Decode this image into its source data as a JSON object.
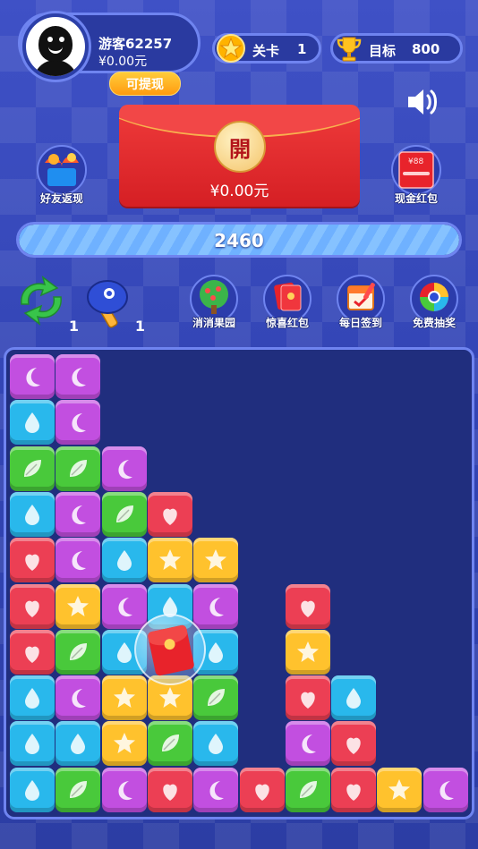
{
  "player": {
    "name": "游客62257",
    "money": "¥0.00元",
    "withdraw_label": "可提现"
  },
  "level": {
    "label": "关卡",
    "value": "1"
  },
  "target": {
    "label": "目标",
    "value": "800"
  },
  "red_packet": {
    "open_char": "開",
    "amount": "¥0.00元"
  },
  "side_buttons": {
    "friend_cashback": "好友返现",
    "cash_red_packet": "现金红包",
    "cash_red_packet_badge": "¥88"
  },
  "score": {
    "value": "2460",
    "progress": 1.0
  },
  "tools": {
    "refresh": {
      "icon": "refresh-arrows-icon",
      "count": "1"
    },
    "hammer": {
      "icon": "hammer-icon",
      "count": "1"
    }
  },
  "features": [
    {
      "label": "消消果园",
      "icon": "tree-icon"
    },
    {
      "label": "惊喜红包",
      "icon": "red-envelope-icon"
    },
    {
      "label": "每日签到",
      "icon": "calendar-icon"
    },
    {
      "label": "免费抽奖",
      "icon": "prize-wheel-icon"
    }
  ],
  "colors": {
    "purple": "#c24fe0",
    "blue": "#29b8ec",
    "green": "#49c93b",
    "red": "#ec3f54",
    "yellow": "#ffc22d",
    "accent": "#6f84f0"
  },
  "board": {
    "columns": 10,
    "rows": 10,
    "grid_from_top": [
      "P P . . . . . . . .",
      "B P . . . . . . . .",
      "G G P . . . . . . .",
      "B P G R . . . . . .",
      "R P B Y Y . . . . .",
      "R Y P B P . R . . .",
      "R G B X B . Y . . .",
      "B P Y Y G . R B . .",
      "B B Y G B . P R . .",
      "B G P R P R G R Y P"
    ],
    "legend": {
      "P": "purple-moon",
      "B": "blue-drop",
      "G": "green-leaf",
      "R": "red-strawberry",
      "Y": "yellow-star",
      "X": "red-packet-bubble"
    }
  }
}
